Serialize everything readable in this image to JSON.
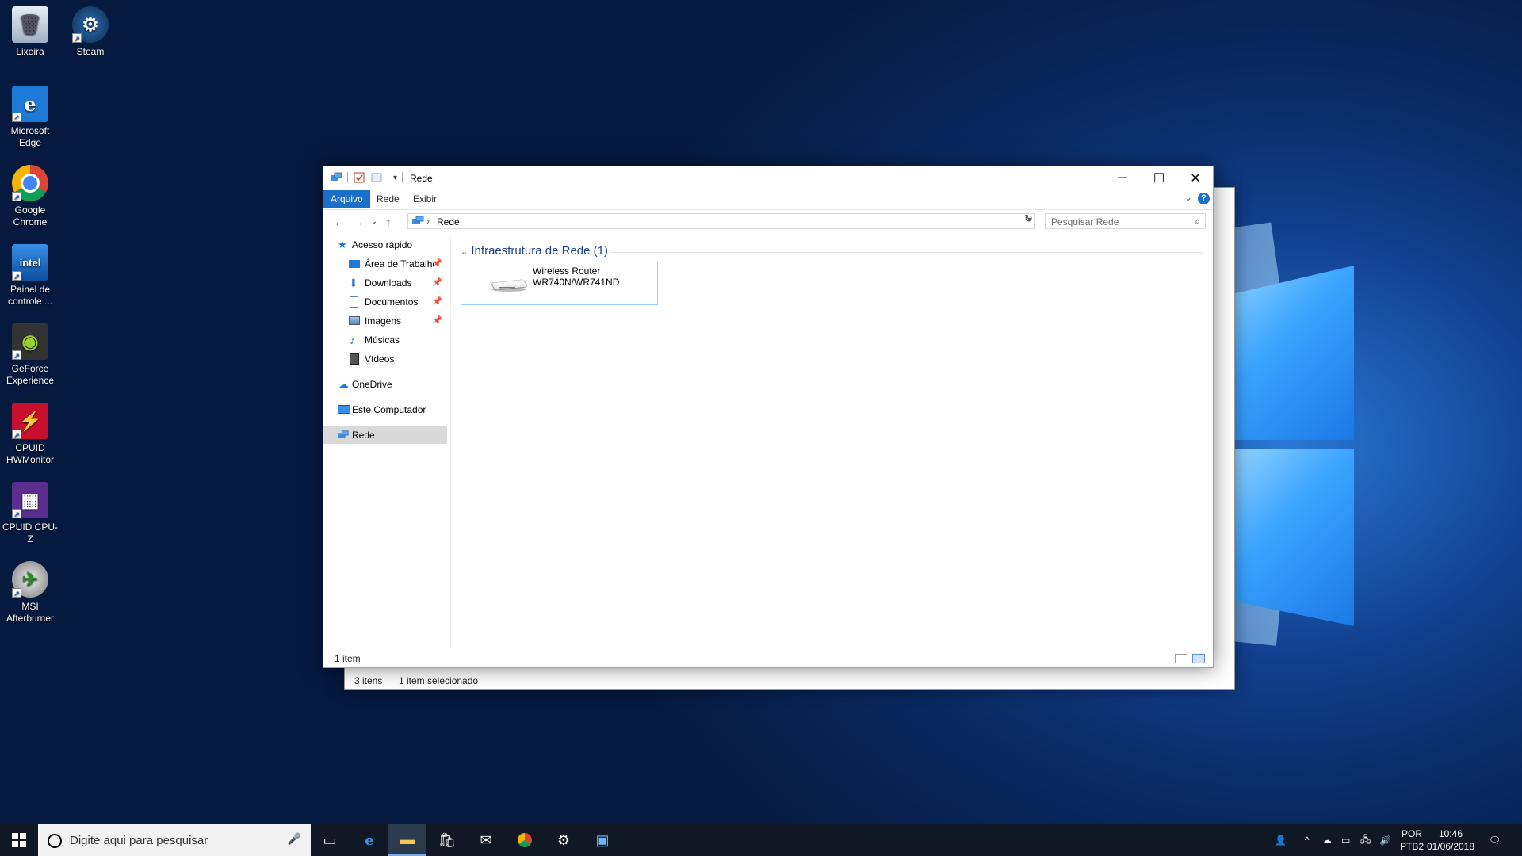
{
  "desktop": {
    "icons": [
      {
        "label": "Lixeira"
      },
      {
        "label": "Steam"
      },
      {
        "label": "Microsoft Edge"
      },
      {
        "label": "Google Chrome"
      },
      {
        "label": "Painel de controle ..."
      },
      {
        "label": "GeForce Experience"
      },
      {
        "label": "CPUID HWMonitor"
      },
      {
        "label": "CPUID CPU-Z"
      },
      {
        "label": "MSI Afterburner"
      }
    ]
  },
  "back_window": {
    "status_count": "3 itens",
    "status_selected": "1 item selecionado"
  },
  "window": {
    "title": "Rede",
    "ribbon_tabs": [
      {
        "label": "Arquivo",
        "active": true
      },
      {
        "label": "Rede",
        "active": false
      },
      {
        "label": "Exibir",
        "active": false
      }
    ],
    "help_label": "?",
    "address_path": "Rede",
    "search_placeholder": "Pesquisar Rede",
    "sidebar": {
      "quick_access": "Acesso rápido",
      "items": [
        {
          "label": "Área de Trabalho",
          "pinned": true
        },
        {
          "label": "Downloads",
          "pinned": true
        },
        {
          "label": "Documentos",
          "pinned": true
        },
        {
          "label": "Imagens",
          "pinned": true
        },
        {
          "label": "Músicas",
          "pinned": false
        },
        {
          "label": "Vídeos",
          "pinned": false
        }
      ],
      "onedrive": "OneDrive",
      "this_pc": "Este Computador",
      "network": "Rede"
    },
    "group_header": "Infraestrutura de Rede (1)",
    "item": {
      "line1": "Wireless Router",
      "line2": "WR740N/WR741ND"
    },
    "status_count": "1 item"
  },
  "taskbar": {
    "search_placeholder": "Digite aqui para pesquisar",
    "lang_line1": "POR",
    "lang_line2": "PTB2",
    "time": "10:46",
    "date": "01/06/2018"
  },
  "colors": {
    "accent": "#1a6fc9",
    "selection_border": "#99d1ff",
    "group_header": "#1e3f8a",
    "taskbar": "#101826"
  }
}
